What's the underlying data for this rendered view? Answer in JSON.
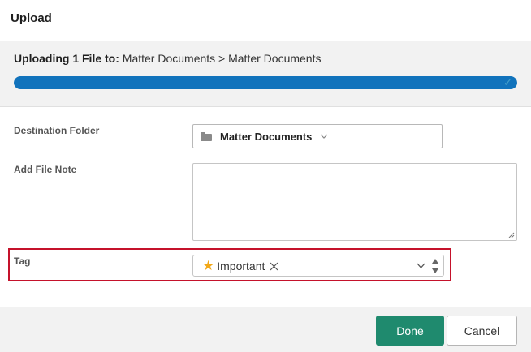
{
  "dialog": {
    "title": "Upload"
  },
  "upload": {
    "prefix": "Uploading 1 File to:",
    "path": "Matter Documents > Matter Documents",
    "progress_percent": 100
  },
  "fields": {
    "destination_label": "Destination Folder",
    "destination_value": "Matter Documents",
    "note_label": "Add File Note",
    "note_value": "",
    "tag_label": "Tag",
    "tag_value": "Important"
  },
  "buttons": {
    "done": "Done",
    "cancel": "Cancel"
  },
  "colors": {
    "progress": "#1173bc",
    "done_button": "#1f8a6e",
    "highlight": "#c5122b",
    "star": "#f2a818"
  },
  "icons": [
    "folder-icon",
    "chevron-down-icon",
    "star-icon",
    "close-icon",
    "spinner-up-icon",
    "spinner-down-icon",
    "checkmark-icon"
  ]
}
